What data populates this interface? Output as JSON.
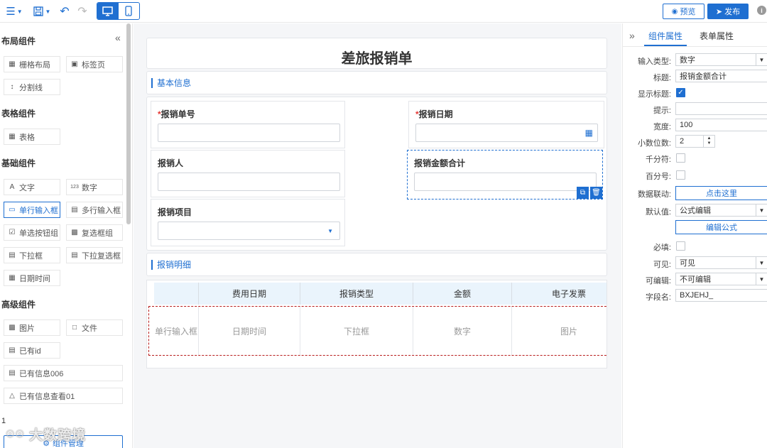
{
  "toolbar": {
    "preview_label": "预览",
    "publish_label": "发布"
  },
  "sidebar": {
    "groups": [
      {
        "title": "布局组件",
        "items": [
          "栅格布局",
          "标签页",
          "分割线"
        ]
      },
      {
        "title": "表格组件",
        "items": [
          "表格"
        ]
      },
      {
        "title": "基础组件",
        "items": [
          "文字",
          "数字",
          "单行输入框",
          "多行输入框",
          "单选按钮组",
          "复选框组",
          "下拉框",
          "下拉复选框",
          "日期时间"
        ]
      },
      {
        "title": "高级组件",
        "items": [
          "图片",
          "文件",
          "已有id",
          "已有信息006",
          "已有信息查看01"
        ]
      }
    ],
    "page_number": "1",
    "manage_label": "组件管理",
    "watermark_text": "大数跨境"
  },
  "form": {
    "title": "差旅报销单",
    "section_basic": "基本信息",
    "fields": {
      "report_no": "报销单号",
      "report_date": "报销日期",
      "reporter": "报销人",
      "total_amount": "报销金额合计",
      "project": "报销项目"
    },
    "section_detail": "报销明细",
    "table": {
      "headers": [
        "费用日期",
        "报销类型",
        "金额",
        "电子发票"
      ],
      "cells": [
        "单行输入框",
        "日期时间",
        "下拉框",
        "数字",
        "图片"
      ]
    }
  },
  "panel": {
    "tab_component": "组件属性",
    "tab_form": "表单属性",
    "props": {
      "input_type_label": "输入类型:",
      "input_type_value": "数字",
      "title_label": "标题:",
      "title_value": "报销金额合计",
      "show_title_label": "显示标题:",
      "hint_label": "提示:",
      "hint_value": "",
      "width_label": "宽度:",
      "width_value": "100",
      "decimals_label": "小数位数:",
      "decimals_value": "2",
      "thousands_label": "千分符:",
      "percent_label": "百分号:",
      "linkage_label": "数据联动:",
      "linkage_button": "点击这里",
      "default_label": "默认值:",
      "default_value": "公式编辑",
      "edit_formula_button": "编辑公式",
      "required_label": "必填:",
      "visible_label": "可见:",
      "visible_value": "可见",
      "editable_label": "可编辑:",
      "editable_value": "不可编辑",
      "field_name_label": "字段名:",
      "field_name_value": "BXJEHJ_"
    }
  },
  "colors": {
    "accent": "#1f6fd1",
    "required_star": "#e53935",
    "table_header_bg": "#eaf4fc",
    "canvas_bg": "#f5f6f8"
  }
}
